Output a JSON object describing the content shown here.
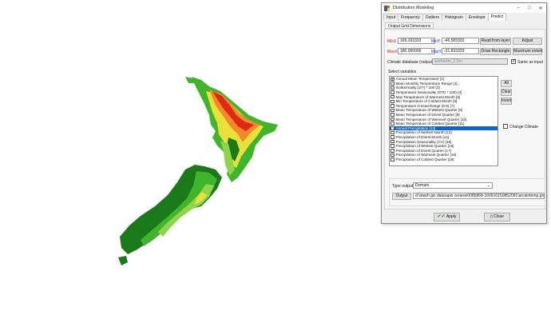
{
  "window": {
    "title": "Distribution Modeling",
    "controls": [
      "minimize-icon",
      "maximize-icon",
      "close-icon"
    ]
  },
  "tabs": [
    "Input",
    "Frequency",
    "Outliers",
    "Histogram",
    "Envelope",
    "Predict"
  ],
  "active_tab": "Predict",
  "subtab": "Output Grid Dimensions",
  "bounds": {
    "minx_label": "MinX",
    "minx_value": "165.333333",
    "maxx_label": "MaxX",
    "maxx_value": "180.000000",
    "miny_label": "MinY",
    "miny_value": "-46.583333",
    "maxy_label": "MaxY",
    "maxy_value": "-31.833333"
  },
  "buttons": {
    "read_from_layer": "Read from layer",
    "adjust": "Adjust",
    "draw_rectangle": "Draw Rectangle",
    "maximum_extent": "Maximum extent",
    "all": "All",
    "clear": "Clear",
    "invert": "Invert",
    "output": "Output",
    "apply": "Apply",
    "close": "Close"
  },
  "climate_database": {
    "label": "Climate database (output)",
    "value": "worldclim_2.5m",
    "same_as_input_label": "Same as input",
    "same_as_input_checked": true
  },
  "select_variables_label": "Select variables",
  "variables": [
    {
      "label": "Annual Mean Temperature [1]",
      "checked": true,
      "selected": false
    },
    {
      "label": "Mean Monthly Temperature Range [2]",
      "checked": false,
      "selected": false
    },
    {
      "label": "Isothermality (2/7) * 100 [3]",
      "checked": false,
      "selected": false
    },
    {
      "label": "Temperature Seasonality (STD * 100) [4]",
      "checked": false,
      "selected": false
    },
    {
      "label": "Max Temperature of Warmest Month [5]",
      "checked": false,
      "selected": false
    },
    {
      "label": "Min Temperature of Coldest Month [6]",
      "checked": false,
      "selected": false
    },
    {
      "label": "Temperature Annual Range (5-6) [7]",
      "checked": false,
      "selected": false
    },
    {
      "label": "Mean Temperature of Wettest Quarter [8]",
      "checked": false,
      "selected": false
    },
    {
      "label": "Mean Temperature of Driest Quarter [9]",
      "checked": false,
      "selected": false
    },
    {
      "label": "Mean Temperature of Warmest Quarter [10]",
      "checked": false,
      "selected": false
    },
    {
      "label": "Mean Temperature of Coldest Quarter [11]",
      "checked": false,
      "selected": false
    },
    {
      "label": "Annual Precipitation [12]",
      "checked": true,
      "selected": true
    },
    {
      "label": "Precipitation of Wettest Month [13]",
      "checked": false,
      "selected": false
    },
    {
      "label": "Precipitation of Driest Month [14]",
      "checked": false,
      "selected": false
    },
    {
      "label": "Precipitation Seasonality (CV) [15]",
      "checked": false,
      "selected": false
    },
    {
      "label": "Precipitation of Wettest Quarter [16]",
      "checked": false,
      "selected": false
    },
    {
      "label": "Precipitation of Driest Quarter [17]",
      "checked": false,
      "selected": false
    },
    {
      "label": "Precipitation of Warmest Quarter [18]",
      "checked": false,
      "selected": false
    },
    {
      "label": "Precipitation of Coldest Quarter [19]",
      "checked": false,
      "selected": false
    }
  ],
  "change_climate": {
    "label": "Change Climate",
    "checked": false
  },
  "type_output": {
    "label": "Type output",
    "value": "Domain"
  },
  "output_path": "d:\\steph gis data\\apis cerana\\0085868-160910150852091\\arcaintemp.grd",
  "colors": {
    "selection": "#0a64d6",
    "map_dark_green": "#1a7a1a",
    "map_green": "#3fb52c",
    "map_light_green": "#8fd44a",
    "map_yellow": "#e9e03a",
    "map_orange": "#f08a2a",
    "map_red": "#e02818"
  }
}
